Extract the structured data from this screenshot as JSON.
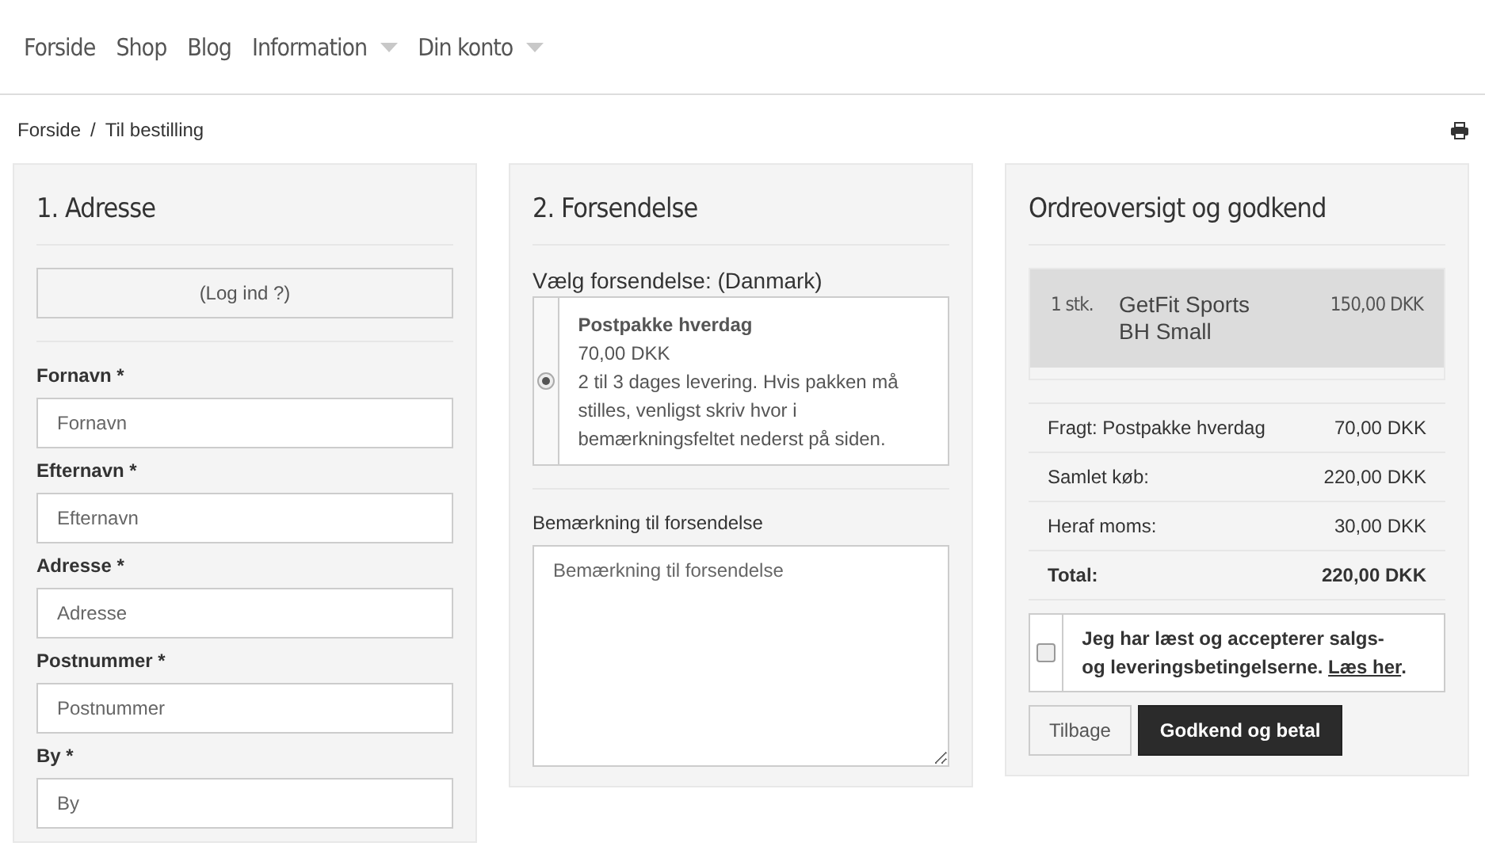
{
  "nav": {
    "items": [
      {
        "label": "Forside",
        "has_dropdown": false
      },
      {
        "label": "Shop",
        "has_dropdown": false
      },
      {
        "label": "Blog",
        "has_dropdown": false
      },
      {
        "label": "Information",
        "has_dropdown": true
      },
      {
        "label": "Din konto",
        "has_dropdown": true
      }
    ]
  },
  "breadcrumb": {
    "items": [
      "Forside",
      "Til bestilling"
    ],
    "separator": "/"
  },
  "address": {
    "title": "1. Adresse",
    "login_button": "(Log ind ?)",
    "fields": [
      {
        "label": "Fornavn *",
        "placeholder": "Fornavn"
      },
      {
        "label": "Efternavn *",
        "placeholder": "Efternavn"
      },
      {
        "label": "Adresse *",
        "placeholder": "Adresse"
      },
      {
        "label": "Postnummer *",
        "placeholder": "Postnummer"
      },
      {
        "label": "By *",
        "placeholder": "By"
      }
    ]
  },
  "shipping": {
    "title": "2. Forsendelse",
    "choose_label": "Vælg forsendelse: (Danmark)",
    "options": [
      {
        "name": "Postpakke hverdag",
        "price": "70,00 DKK",
        "description": "2 til 3 dages levering. Hvis pakken må stilles, venligst skriv hvor i bemærkningsfeltet nederst på siden.",
        "selected": true
      }
    ],
    "note_label": "Bemærkning til forsendelse",
    "note_placeholder": "Bemærkning til forsendelse"
  },
  "order": {
    "title": "Ordreoversigt og godkend",
    "items": [
      {
        "qty": "1 stk.",
        "name": "GetFit Sports BH Small",
        "price": "150,00 DKK"
      }
    ],
    "summary": [
      {
        "label": "Fragt: Postpakke hverdag",
        "value": "70,00 DKK",
        "kind": "normal"
      },
      {
        "label": "Samlet køb:",
        "value": "220,00 DKK",
        "kind": "normal"
      },
      {
        "label": "Heraf moms:",
        "value": "30,00 DKK",
        "kind": "normal"
      },
      {
        "label": "Total:",
        "value": "220,00 DKK",
        "kind": "total"
      }
    ],
    "terms": {
      "before": "Jeg har læst og accepterer salgs- og leveringsbetingelserne.",
      "link": "Læs her",
      "after": ".",
      "checked": false
    },
    "buttons": [
      {
        "label": "Tilbage",
        "kind": "secondary"
      },
      {
        "label": "Godkend og betal",
        "kind": "primary"
      }
    ]
  }
}
